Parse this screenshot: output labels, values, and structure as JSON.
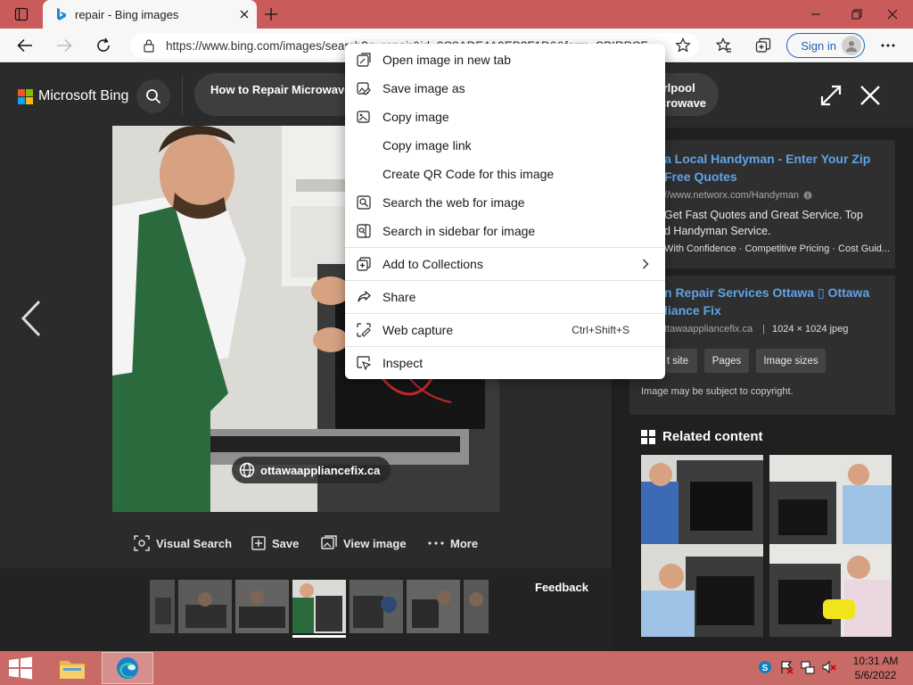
{
  "browser": {
    "tab_title": "repair - Bing images",
    "url": "https://www.bing.com/images/search?q=repair&id=3C8ADF4A9EB2F1D6&form=SBIRPCE09",
    "signin_label": "Sign in"
  },
  "header": {
    "brand": "Microsoft Bing",
    "pill_left": "How to Repair Microwave",
    "pill_right_line1": "irlpool",
    "pill_right_line2": "crowave"
  },
  "viewer": {
    "source_badge": "ottawaappliancefix.ca",
    "actions": [
      "Visual Search",
      "Save",
      "View image",
      "More"
    ],
    "feedback": "Feedback"
  },
  "right_panel": {
    "ad": {
      "title_line1": "a Local Handyman - Enter Your Zip",
      "title_line2": "Free Quotes",
      "url": "//www.networx.com/Handyman",
      "desc_line1": "Get Fast Quotes and Great Service. Top",
      "desc_line2": "d Handyman Service.",
      "features": "With Confidence · Competitive Pricing · Cost Guid..."
    },
    "result": {
      "title_line1": "n Repair Services Ottawa ▯ Ottawa",
      "title_line2": "liance Fix",
      "source": "ttawaappliancefix.ca",
      "meta": "1024 × 1024 jpeg",
      "chips": [
        "t site",
        "Pages",
        "Image sizes"
      ],
      "copyright": "Image may be subject to copyright."
    },
    "related_title": "Related content"
  },
  "context_menu": {
    "items": [
      {
        "label": "Open image in new tab",
        "icon": "open-new-tab-icon"
      },
      {
        "label": "Save image as",
        "icon": "save-image-icon"
      },
      {
        "label": "Copy image",
        "icon": "copy-image-icon"
      },
      {
        "label": "Copy image link",
        "icon": ""
      },
      {
        "label": "Create QR Code for this image",
        "icon": ""
      },
      {
        "label": "Search the web for image",
        "icon": "visual-search-icon"
      },
      {
        "label": "Search in sidebar for image",
        "icon": "sidebar-search-icon"
      },
      {
        "label": "Add to Collections",
        "icon": "collections-icon"
      },
      {
        "label": "Share",
        "icon": "share-icon"
      },
      {
        "label": "Web capture",
        "icon": "web-capture-icon",
        "shortcut": "Ctrl+Shift+S"
      },
      {
        "label": "Inspect",
        "icon": "inspect-icon"
      }
    ]
  },
  "taskbar": {
    "time": "10:31 AM",
    "date": "5/6/2022"
  },
  "colors": {
    "titlebar": "#c95b5b",
    "taskbar": "#c86a66",
    "link": "#5fa3e8",
    "bing_red": "#f35325",
    "bing_green": "#81bc06",
    "bing_blue": "#05a6f0",
    "bing_yellow": "#ffba08"
  }
}
